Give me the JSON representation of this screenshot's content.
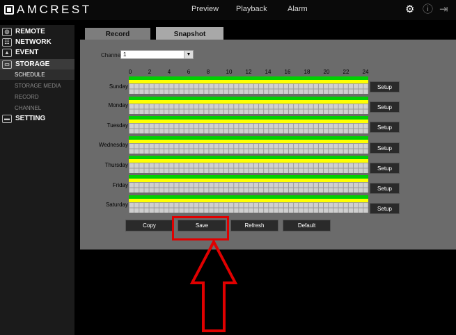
{
  "topbar": {
    "brand": "AMCREST",
    "nav": [
      "Preview",
      "Playback",
      "Alarm"
    ],
    "icons": [
      "gear-icon",
      "info-icon",
      "logout-icon"
    ]
  },
  "sidebar": {
    "items": [
      {
        "label": "REMOTE",
        "icon": "remote-icon"
      },
      {
        "label": "NETWORK",
        "icon": "network-icon"
      },
      {
        "label": "EVENT",
        "icon": "event-icon"
      },
      {
        "label": "STORAGE",
        "icon": "storage-icon"
      },
      {
        "label": "SETTING",
        "icon": "setting-icon"
      }
    ],
    "storage_sub": [
      "SCHEDULE",
      "STORAGE MEDIA",
      "RECORD",
      "CHANNEL"
    ]
  },
  "tabs": [
    "Record",
    "Snapshot"
  ],
  "channel": {
    "label": "Channel",
    "value": "1"
  },
  "hours": [
    "0",
    "2",
    "4",
    "6",
    "8",
    "10",
    "12",
    "14",
    "16",
    "18",
    "20",
    "22",
    "24"
  ],
  "days": [
    "Sunday",
    "Monday",
    "Tuesday",
    "Wednesday",
    "Thursday",
    "Friday",
    "Saturday"
  ],
  "setup_label": "Setup",
  "buttons": {
    "copy": "Copy",
    "save": "Save",
    "refresh": "Refresh",
    "default": "Default"
  },
  "colors": {
    "regular_bar": "#00d000",
    "motion_bar": "#ffff00",
    "highlight": "#e00000"
  }
}
